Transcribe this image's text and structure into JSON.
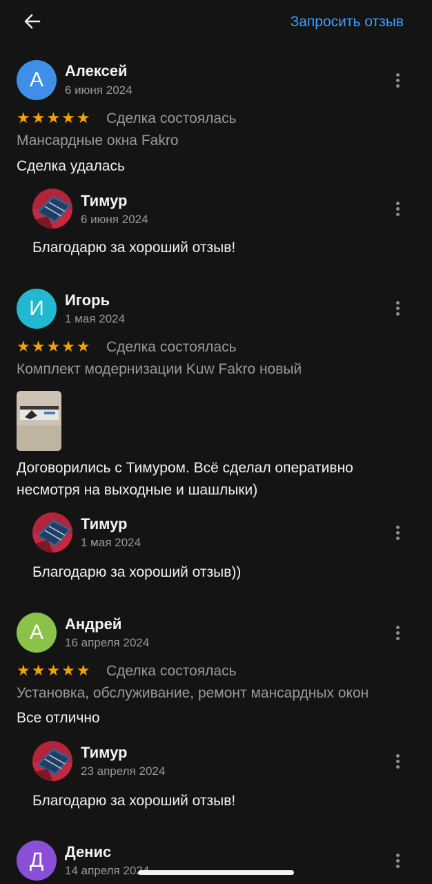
{
  "header": {
    "request_label": "Запросить отзыв"
  },
  "colors": {
    "accent": "#3aa0ff",
    "star": "#f6a300"
  },
  "reviews": [
    {
      "initial": "А",
      "avatar_color": "#3f8ee8",
      "name": "Алексей",
      "date": "6 июня 2024",
      "stars": "★★★★★",
      "deal": "Сделка состоялась",
      "product": "Мансардные окна Fakro",
      "text": "Сделка удалась",
      "reply": {
        "name": "Тимур",
        "date": "6 июня 2024",
        "text": "Благодарю за хороший отзыв!"
      }
    },
    {
      "initial": "И",
      "avatar_color": "#22b8cf",
      "name": "Игорь",
      "date": "1 мая 2024",
      "stars": "★★★★★",
      "deal": "Сделка состоялась",
      "product": "Комплект модернизации Kuw Fakro новый",
      "text_line1": "Договорились с Тимуром. Всё сделал оперативно",
      "text_line2": "несмотря на выходные и шашлыки)",
      "reply": {
        "name": "Тимур",
        "date": "1 мая 2024",
        "text": "Благодарю за хороший отзыв))"
      }
    },
    {
      "initial": "А",
      "avatar_color": "#8bc34a",
      "name": "Андрей",
      "date": "16 апреля 2024",
      "stars": "★★★★★",
      "deal": "Сделка состоялась",
      "product": "Установка, обслуживание, ремонт мансардных окон",
      "text": "Все отлично",
      "reply": {
        "name": "Тимур",
        "date": "23 апреля 2024",
        "text": "Благодарю за хороший отзыв!"
      }
    },
    {
      "initial": "Д",
      "avatar_color": "#8a4fd6",
      "name": "Денис",
      "date": "14 апреля 2024"
    }
  ]
}
